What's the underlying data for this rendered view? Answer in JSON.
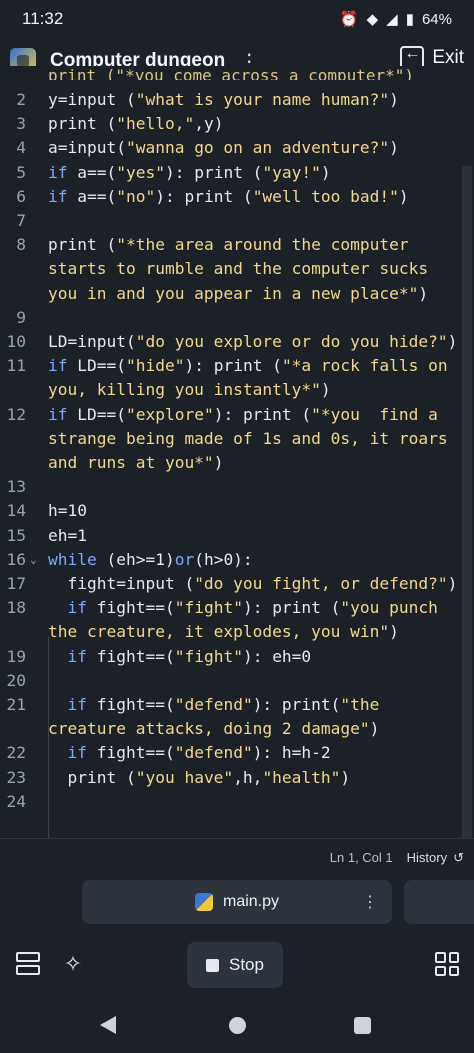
{
  "status_bar": {
    "time": "11:32",
    "battery": "64%"
  },
  "header": {
    "title": "Computer dungeon",
    "exit_label": "Exit"
  },
  "editor": {
    "partial_top": "print (\"*you come across a computer*\")",
    "lines": [
      {
        "n": "2",
        "parts": [
          [
            "t",
            "y=input ("
          ],
          [
            "s",
            "\"what is your name human?\""
          ],
          [
            "t",
            ")"
          ]
        ]
      },
      {
        "n": "3",
        "parts": [
          [
            "t",
            "print ("
          ],
          [
            "s",
            "\"hello,\""
          ],
          [
            "t",
            ",y)"
          ]
        ]
      },
      {
        "n": "4",
        "parts": [
          [
            "t",
            "a=input("
          ],
          [
            "s",
            "\"wanna go on an adventure?\""
          ],
          [
            "t",
            ")"
          ]
        ]
      },
      {
        "n": "5",
        "parts": [
          [
            "k",
            "if"
          ],
          [
            "t",
            " a==("
          ],
          [
            "s",
            "\"yes\""
          ],
          [
            "t",
            "): print ("
          ],
          [
            "s",
            "\"yay!\""
          ],
          [
            "t",
            ")"
          ]
        ]
      },
      {
        "n": "6",
        "parts": [
          [
            "k",
            "if"
          ],
          [
            "t",
            " a==("
          ],
          [
            "s",
            "\"no\""
          ],
          [
            "t",
            "): print ("
          ],
          [
            "s",
            "\"well too bad!\""
          ],
          [
            "t",
            ")"
          ]
        ]
      },
      {
        "n": "7",
        "parts": []
      },
      {
        "n": "8",
        "parts": [
          [
            "t",
            "print ("
          ],
          [
            "s",
            "\"*the area around the computer"
          ]
        ]
      },
      {
        "n": "",
        "parts": [
          [
            "s",
            "starts to rumble and the computer sucks"
          ]
        ]
      },
      {
        "n": "",
        "parts": [
          [
            "s",
            "you in and you appear in a new place*\""
          ],
          [
            "t",
            ")"
          ]
        ]
      },
      {
        "n": "9",
        "parts": []
      },
      {
        "n": "10",
        "parts": [
          [
            "t",
            "LD=input("
          ],
          [
            "s",
            "\"do you explore or do you hide?\""
          ],
          [
            "t",
            ")"
          ]
        ]
      },
      {
        "n": "11",
        "parts": [
          [
            "k",
            "if"
          ],
          [
            "t",
            " LD==("
          ],
          [
            "s",
            "\"hide\""
          ],
          [
            "t",
            "): print ("
          ],
          [
            "s",
            "\"*a rock falls on"
          ]
        ]
      },
      {
        "n": "",
        "parts": [
          [
            "s",
            "you, killing you instantly*\""
          ],
          [
            "t",
            ")"
          ]
        ]
      },
      {
        "n": "12",
        "parts": [
          [
            "k",
            "if"
          ],
          [
            "t",
            " LD==("
          ],
          [
            "s",
            "\"explore\""
          ],
          [
            "t",
            "): print ("
          ],
          [
            "s",
            "\"*you  find a"
          ]
        ]
      },
      {
        "n": "",
        "parts": [
          [
            "s",
            "strange being made of 1s and 0s, it roars"
          ]
        ]
      },
      {
        "n": "",
        "parts": [
          [
            "s",
            "and runs at you*\""
          ],
          [
            "t",
            ")"
          ]
        ]
      },
      {
        "n": "13",
        "parts": []
      },
      {
        "n": "14",
        "parts": [
          [
            "t",
            "h=10"
          ]
        ]
      },
      {
        "n": "15",
        "parts": [
          [
            "t",
            "eh=1"
          ]
        ]
      },
      {
        "n": "16",
        "fold": true,
        "parts": [
          [
            "k",
            "while"
          ],
          [
            "t",
            " (eh>=1)"
          ],
          [
            "k",
            "or"
          ],
          [
            "t",
            "(h>0):"
          ]
        ]
      },
      {
        "n": "17",
        "parts": [
          [
            "t",
            "  fight=input ("
          ],
          [
            "s",
            "\"do you fight, or defend?\""
          ],
          [
            "t",
            ")"
          ]
        ]
      },
      {
        "n": "18",
        "parts": [
          [
            "t",
            "  "
          ],
          [
            "k",
            "if"
          ],
          [
            "t",
            " fight==("
          ],
          [
            "s",
            "\"fight\""
          ],
          [
            "t",
            "): print ("
          ],
          [
            "s",
            "\"you punch"
          ]
        ]
      },
      {
        "n": "",
        "parts": [
          [
            "s",
            "the creature, it explodes, you win\""
          ],
          [
            "t",
            ")"
          ]
        ]
      },
      {
        "n": "19",
        "parts": [
          [
            "t",
            "  "
          ],
          [
            "k",
            "if"
          ],
          [
            "t",
            " fight==("
          ],
          [
            "s",
            "\"fight\""
          ],
          [
            "t",
            "): eh=0"
          ]
        ]
      },
      {
        "n": "20",
        "parts": []
      },
      {
        "n": "21",
        "parts": [
          [
            "t",
            "  "
          ],
          [
            "k",
            "if"
          ],
          [
            "t",
            " fight==("
          ],
          [
            "s",
            "\"defend\""
          ],
          [
            "t",
            "): print("
          ],
          [
            "s",
            "\"the"
          ]
        ]
      },
      {
        "n": "",
        "parts": [
          [
            "s",
            "creature attacks, doing 2 damage\""
          ],
          [
            "t",
            ")"
          ]
        ]
      },
      {
        "n": "22",
        "parts": [
          [
            "t",
            "  "
          ],
          [
            "k",
            "if"
          ],
          [
            "t",
            " fight==("
          ],
          [
            "s",
            "\"defend\""
          ],
          [
            "t",
            "): h=h-2"
          ]
        ]
      },
      {
        "n": "23",
        "parts": [
          [
            "t",
            "  print ("
          ],
          [
            "s",
            "\"you have\""
          ],
          [
            "t",
            ",h,"
          ],
          [
            "s",
            "\"health\""
          ],
          [
            "t",
            ")"
          ]
        ]
      },
      {
        "n": "24",
        "parts": []
      }
    ]
  },
  "footer": {
    "cursor": "Ln 1, Col 1",
    "history_label": "History"
  },
  "tabs": {
    "active_file": "main.py"
  },
  "toolbar": {
    "stop_label": "Stop"
  }
}
